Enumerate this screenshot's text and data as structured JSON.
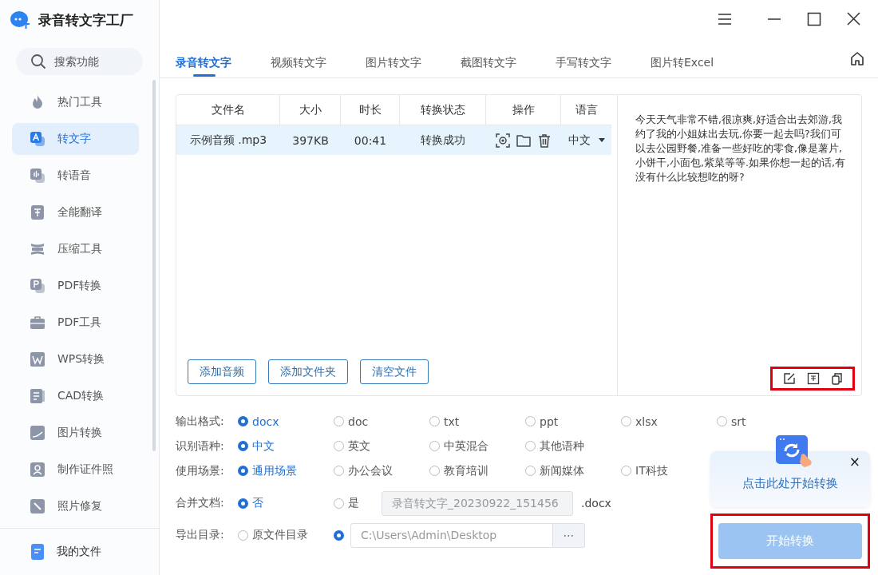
{
  "app": {
    "title": "录音转文字工厂"
  },
  "sidebar": {
    "search": {
      "placeholder": "搜索功能"
    },
    "items": [
      {
        "label": "热门工具",
        "selected": false
      },
      {
        "label": "转文字",
        "selected": true
      },
      {
        "label": "转语音",
        "selected": false
      },
      {
        "label": "全能翻译",
        "selected": false
      },
      {
        "label": "压缩工具",
        "selected": false
      },
      {
        "label": "PDF转换",
        "selected": false
      },
      {
        "label": "PDF工具",
        "selected": false
      },
      {
        "label": "WPS转换",
        "selected": false
      },
      {
        "label": "CAD转换",
        "selected": false
      },
      {
        "label": "图片转换",
        "selected": false
      },
      {
        "label": "制作证件照",
        "selected": false
      },
      {
        "label": "照片修复",
        "selected": false
      }
    ],
    "footer": {
      "label": "我的文件"
    }
  },
  "tabs": [
    {
      "label": "录音转文字",
      "selected": true
    },
    {
      "label": "视频转文字",
      "selected": false
    },
    {
      "label": "图片转文字",
      "selected": false
    },
    {
      "label": "截图转文字",
      "selected": false
    },
    {
      "label": "手写转文字",
      "selected": false
    },
    {
      "label": "图片转Excel",
      "selected": false
    }
  ],
  "table": {
    "columns": [
      "文件名",
      "大小",
      "时长",
      "转换状态",
      "操作",
      "语言"
    ],
    "rows": [
      {
        "cells": [
          "示例音频 .mp3",
          "397KB",
          "00:41",
          "转换成功"
        ],
        "language": "中文",
        "selected": true
      }
    ]
  },
  "file_buttons": [
    "添加音频",
    "添加文件夹",
    "清空文件"
  ],
  "result": {
    "text": "今天天气非常不错,很凉爽,好适合出去郊游,我约了我的小姐妹出去玩,你要一起去吗?我们可以去公园野餐,准备一些好吃的零食,像是薯片,小饼干,小面包,紫菜等等.如果你想一起的话,有没有什么比较想吃的呀?",
    "tools_highlighted": true
  },
  "options": [
    {
      "label": "输出格式:",
      "kind": "radios",
      "options": [
        {
          "label": "docx",
          "selected": true
        },
        {
          "label": "doc",
          "selected": false
        },
        {
          "label": "txt",
          "selected": false
        },
        {
          "label": "ppt",
          "selected": false
        },
        {
          "label": "xlsx",
          "selected": false
        },
        {
          "label": "srt",
          "selected": false
        }
      ]
    },
    {
      "label": "识别语种:",
      "kind": "radios",
      "options": [
        {
          "label": "中文",
          "selected": true
        },
        {
          "label": "英文",
          "selected": false
        },
        {
          "label": "中英混合",
          "selected": false
        },
        {
          "label": "其他语种",
          "selected": false
        }
      ]
    },
    {
      "label": "使用场景:",
      "kind": "radios",
      "options": [
        {
          "label": "通用场景",
          "selected": true
        },
        {
          "label": "办公会议",
          "selected": false
        },
        {
          "label": "教育培训",
          "selected": false
        },
        {
          "label": "新闻媒体",
          "selected": false
        },
        {
          "label": "IT科技",
          "selected": false
        }
      ]
    },
    {
      "label": "合并文档:",
      "kind": "merge",
      "options": [
        {
          "label": "否",
          "selected": true
        },
        {
          "label": "是",
          "selected": false
        }
      ],
      "field": {
        "value": "录音转文字_20230922_151456",
        "disabled": true
      },
      "suffix": ".docx"
    },
    {
      "label": "导出目录:",
      "kind": "path",
      "options": [
        {
          "label": "原文件目录",
          "selected": false
        },
        {
          "selected": true
        }
      ],
      "field": {
        "value": "C:\\Users\\Admin\\Desktop",
        "disabled": false
      },
      "browse": "⋯"
    }
  ],
  "hint_popup": {
    "text": "点击此处开始转换",
    "close": "×"
  },
  "start_button": {
    "label": "开始转换",
    "disabled": true,
    "highlighted": true
  }
}
